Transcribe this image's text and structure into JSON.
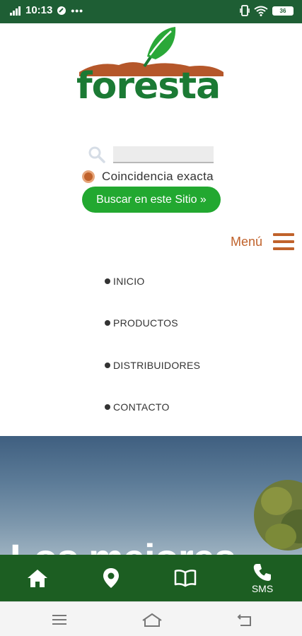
{
  "status_bar": {
    "time": "10:13",
    "battery": "36"
  },
  "logo": {
    "text": "foresta"
  },
  "search": {
    "input_value": "",
    "exact_match_label": "Coincidencia exacta",
    "button_label": "Buscar en este Sitio »"
  },
  "menu": {
    "label": "Menú",
    "items": [
      {
        "label": "INICIO"
      },
      {
        "label": "PRODUCTOS"
      },
      {
        "label": "DISTRIBUIDORES"
      },
      {
        "label": "CONTACTO"
      }
    ]
  },
  "hero": {
    "title": "Los mejores"
  },
  "bottom_nav": {
    "items": [
      {
        "icon": "home-icon"
      },
      {
        "icon": "location-pin-icon"
      },
      {
        "icon": "book-icon"
      },
      {
        "icon": "phone-icon",
        "label": "SMS"
      }
    ]
  },
  "colors": {
    "status_bar": "#1e5e34",
    "brand_green": "#1b7a34",
    "button_green": "#22a830",
    "accent_orange": "#c0622b",
    "bottom_nav": "#1c5e22"
  }
}
